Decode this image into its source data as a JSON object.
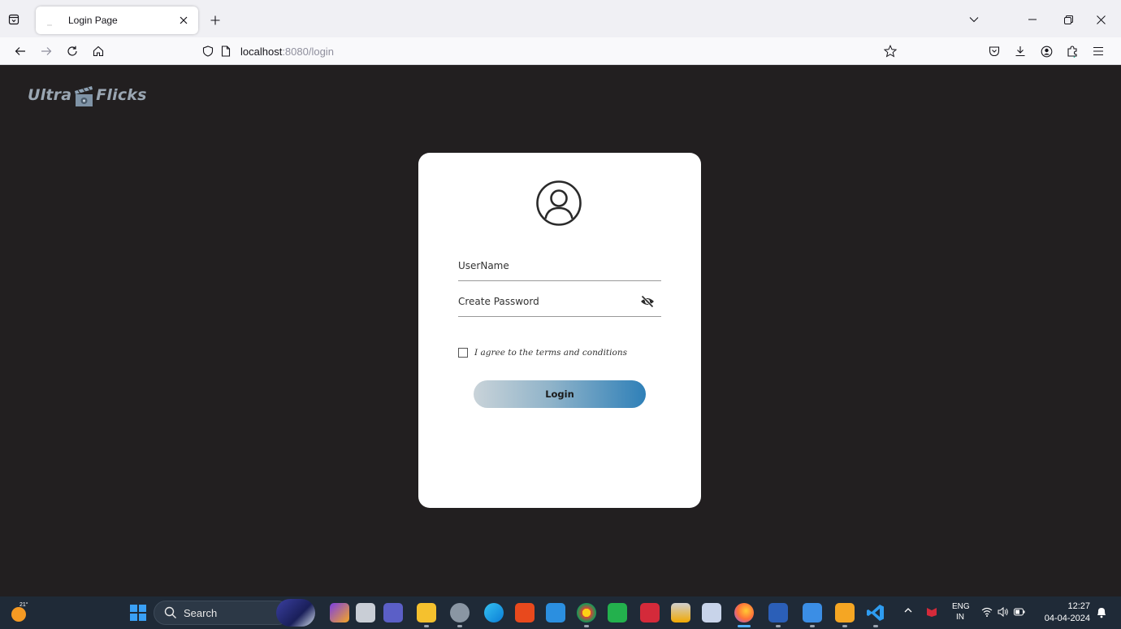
{
  "browser": {
    "tab_title": "Login Page",
    "url_host": "localhost",
    "url_rest": ":8080/login"
  },
  "app": {
    "logo_left": "Ultra",
    "logo_right": "Flicks"
  },
  "login_form": {
    "username_placeholder": "UserName",
    "password_placeholder": "Create Password",
    "terms_label": "I agree to the terms and conditions",
    "login_label": "Login"
  },
  "taskbar": {
    "weather_temp": "21°",
    "search_label": "Search",
    "lang_top": "ENG",
    "lang_bottom": "IN",
    "time": "12:27",
    "date": "04-04-2024"
  },
  "colors": {
    "page_bg": "#221f20",
    "card_bg": "#ffffff",
    "button_gradient_start": "#c9d3d9",
    "button_gradient_end": "#2f80b8"
  }
}
